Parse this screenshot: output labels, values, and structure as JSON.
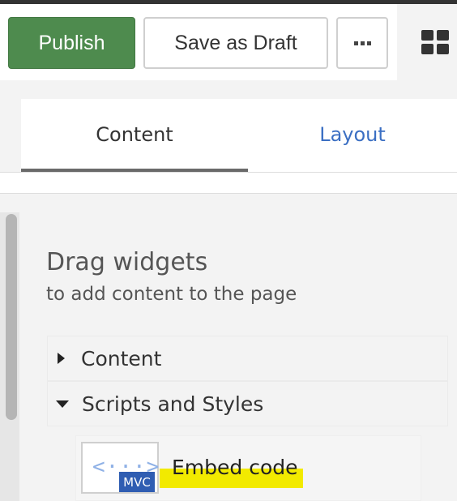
{
  "toolbar": {
    "publish_label": "Publish",
    "draft_label": "Save as Draft",
    "more_icon": "ellipsis-icon",
    "layout_icon": "grid-icon"
  },
  "tabs": [
    {
      "label": "Content",
      "active": true
    },
    {
      "label": "Layout",
      "active": false
    }
  ],
  "widgets_panel": {
    "title": "Drag widgets",
    "subtitle": "to add content to the page",
    "sections": [
      {
        "label": "Content",
        "expanded": false
      },
      {
        "label": "Scripts and Styles",
        "expanded": true
      }
    ],
    "items": [
      {
        "label": "Embed code",
        "badge": "MVC",
        "icon": "embed-code-icon"
      }
    ]
  },
  "colors": {
    "publish": "#4e8b4e",
    "link": "#3b6fc3",
    "badge": "#2f5db2",
    "highlight": "#f2ea00"
  }
}
